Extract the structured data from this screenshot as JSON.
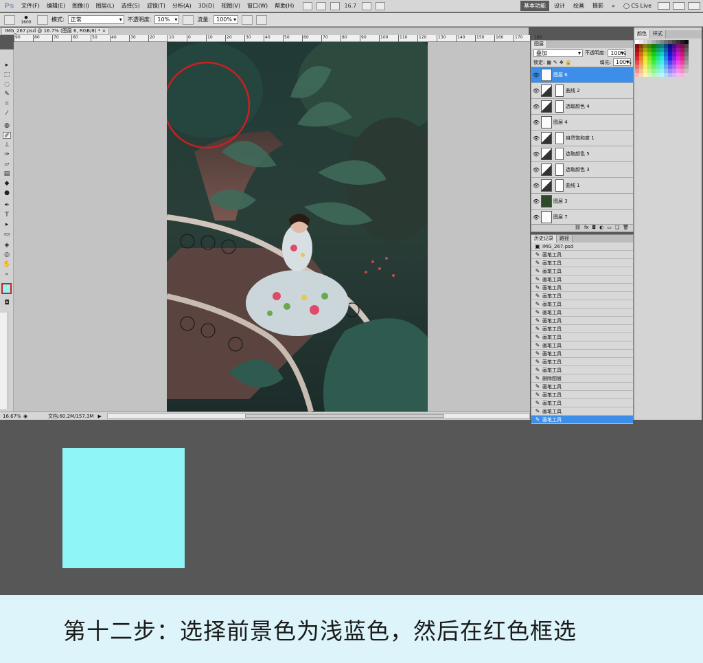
{
  "app": {
    "logo": "Ps",
    "menu": [
      "文件(F)",
      "编辑(E)",
      "图像(I)",
      "图层(L)",
      "选择(S)",
      "滤镜(T)",
      "分析(A)",
      "3D(D)",
      "视图(V)",
      "窗口(W)",
      "帮助(H)"
    ],
    "zoom_display": "16.7",
    "workspaces": [
      "基本功能",
      "设计",
      "绘画",
      "摄影"
    ],
    "more_workspaces": "»",
    "cs_live": "CS Live"
  },
  "options_bar": {
    "brush_size": "1600",
    "mode_label": "模式:",
    "mode_value": "正常",
    "opacity_label": "不透明度:",
    "opacity_value": "10%",
    "flow_label": "流量:",
    "flow_value": "100%"
  },
  "document": {
    "tab_title": "IMG_267.psd @ 16.7% (图层 6, RGB/8) *",
    "ruler_ticks": [
      "90",
      "80",
      "70",
      "60",
      "50",
      "40",
      "30",
      "20",
      "10",
      "0",
      "10",
      "20",
      "30",
      "40",
      "50",
      "60",
      "70",
      "80",
      "90",
      "100",
      "110",
      "120",
      "130",
      "140",
      "150",
      "160",
      "170",
      "180"
    ]
  },
  "status_bar": {
    "zoom": "16.67%",
    "doc_info": "文档:60.2M/157.3M"
  },
  "layers_panel": {
    "tab": "图层",
    "blend_mode": "叠加",
    "opacity_label": "不透明度:",
    "opacity_value": "100%",
    "lock_label": "锁定:",
    "fill_label": "填充:",
    "fill_value": "100%",
    "layers": [
      {
        "name": "图层 6",
        "kind": "blank",
        "selected": true
      },
      {
        "name": "曲线 2",
        "kind": "curves",
        "selected": false
      },
      {
        "name": "选取颜色 4",
        "kind": "adj",
        "selected": false
      },
      {
        "name": "图层 4",
        "kind": "blank",
        "selected": false
      },
      {
        "name": "自然饱和度 1",
        "kind": "adj",
        "selected": false
      },
      {
        "name": "选取颜色 5",
        "kind": "adj",
        "selected": false
      },
      {
        "name": "选取颜色 3",
        "kind": "adj",
        "selected": false
      },
      {
        "name": "曲线 1",
        "kind": "curves",
        "selected": false
      },
      {
        "name": "图层 3",
        "kind": "img",
        "selected": false
      },
      {
        "name": "图层 7",
        "kind": "blank",
        "selected": false
      }
    ]
  },
  "history_panel": {
    "tabs": [
      "历史记录",
      "路径"
    ],
    "snapshot": "IMG_267.psd",
    "items": [
      "画笔工具",
      "画笔工具",
      "画笔工具",
      "画笔工具",
      "画笔工具",
      "画笔工具",
      "画笔工具",
      "画笔工具",
      "画笔工具",
      "画笔工具",
      "画笔工具",
      "画笔工具",
      "画笔工具",
      "画笔工具",
      "画笔工具",
      "删除图层",
      "画笔工具",
      "画笔工具",
      "画笔工具",
      "画笔工具",
      "画笔工具"
    ],
    "selected_index": 20
  },
  "swatches_panel": {
    "tabs": [
      "颜色",
      "样式"
    ]
  },
  "foreground_color": "#8ff5f6",
  "caption": "第十二步：选择前景色为浅蓝色，然后在红色框选"
}
